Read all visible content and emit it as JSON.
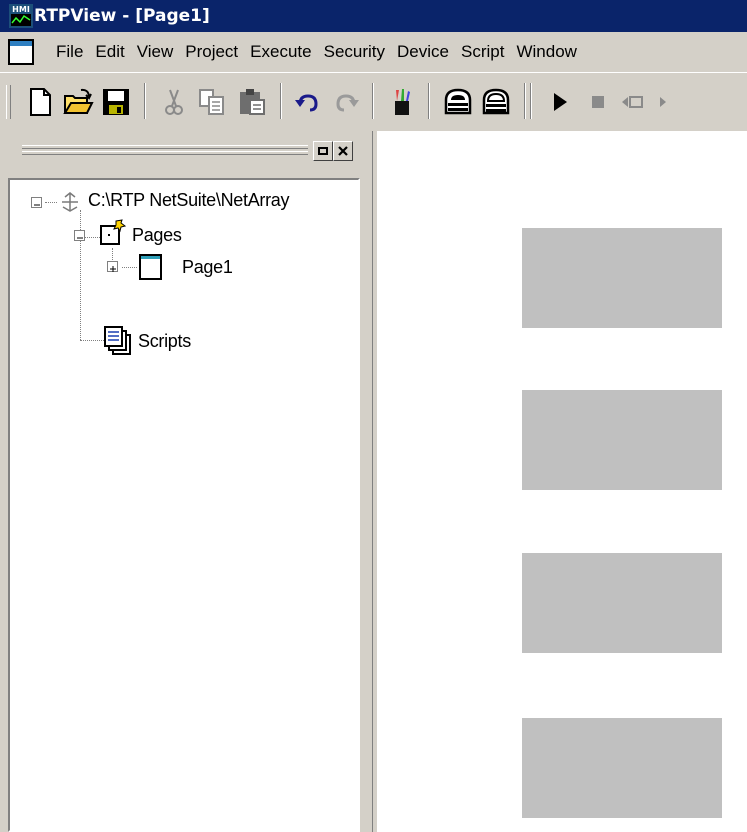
{
  "window": {
    "title": "RTPView - [Page1]",
    "app_icon_text": "HMI"
  },
  "menu": {
    "items": [
      "File",
      "Edit",
      "View",
      "Project",
      "Execute",
      "Security",
      "Device",
      "Script",
      "Window"
    ]
  },
  "toolbar": {
    "buttons": [
      "new-icon",
      "open-icon",
      "save-icon",
      "cut-icon",
      "copy-icon",
      "paste-icon",
      "undo-icon",
      "redo-icon",
      "pens-icon",
      "security-lock-icon",
      "lock-icon",
      "run-icon",
      "stop-icon",
      "step-back-icon"
    ]
  },
  "tree": {
    "root": "C:\\RTP NetSuite\\NetArray",
    "pages_label": "Pages",
    "page1_label": "Page1",
    "scripts_label": "Scripts"
  },
  "colors": {
    "title_bar": "#0a246a",
    "chrome": "#d4d0c8",
    "placeholder_box": "#c0c0c0"
  },
  "canvas": {
    "placeholder_count": 4
  }
}
